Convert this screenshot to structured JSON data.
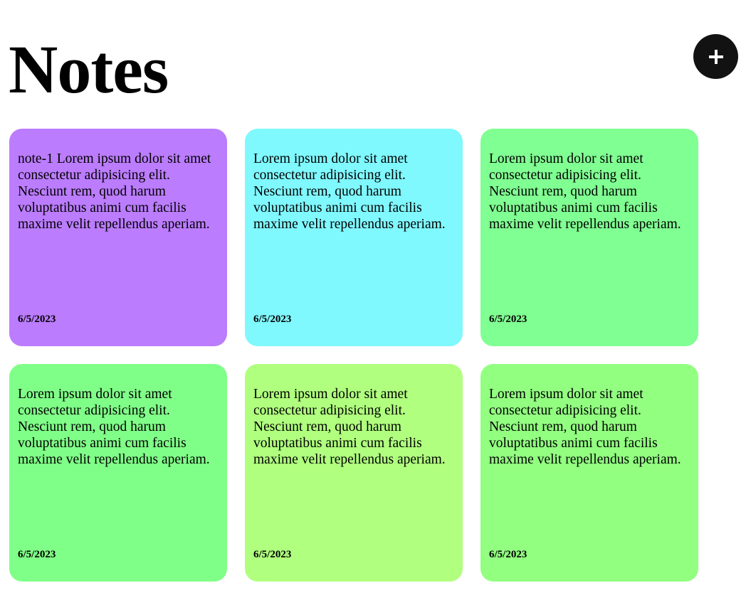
{
  "header": {
    "title": "Notes",
    "add_button_icon": "plus-icon"
  },
  "notes": [
    {
      "text": "note-1 Lorem ipsum dolor sit amet consectetur adipisicing elit. Nesciunt rem, quod harum voluptatibus animi cum facilis maxime velit repellendus aperiam.",
      "date": "6/5/2023",
      "color": "#BB7CFE"
    },
    {
      "text": "Lorem ipsum dolor sit amet consectetur adipisicing elit. Nesciunt rem, quod harum voluptatibus animi cum facilis maxime velit repellendus aperiam.",
      "date": "6/5/2023",
      "color": "#7FF8FE"
    },
    {
      "text": "Lorem ipsum dolor sit amet consectetur adipisicing elit. Nesciunt rem, quod harum voluptatibus animi cum facilis maxime velit repellendus aperiam.",
      "date": "6/5/2023",
      "color": "#80FF92"
    },
    {
      "text": "Lorem ipsum dolor sit amet consectetur adipisicing elit. Nesciunt rem, quod harum voluptatibus animi cum facilis maxime velit repellendus aperiam.",
      "date": "6/5/2023",
      "color": "#80FF88"
    },
    {
      "text": "Lorem ipsum dolor sit amet consectetur adipisicing elit. Nesciunt rem, quod harum voluptatibus animi cum facilis maxime velit repellendus aperiam.",
      "date": "6/5/2023",
      "color": "#B0FF7E"
    },
    {
      "text": "Lorem ipsum dolor sit amet consectetur adipisicing elit. Nesciunt rem, quod harum voluptatibus animi cum facilis maxime velit repellendus aperiam.",
      "date": "6/5/2023",
      "color": "#92FF80"
    }
  ]
}
